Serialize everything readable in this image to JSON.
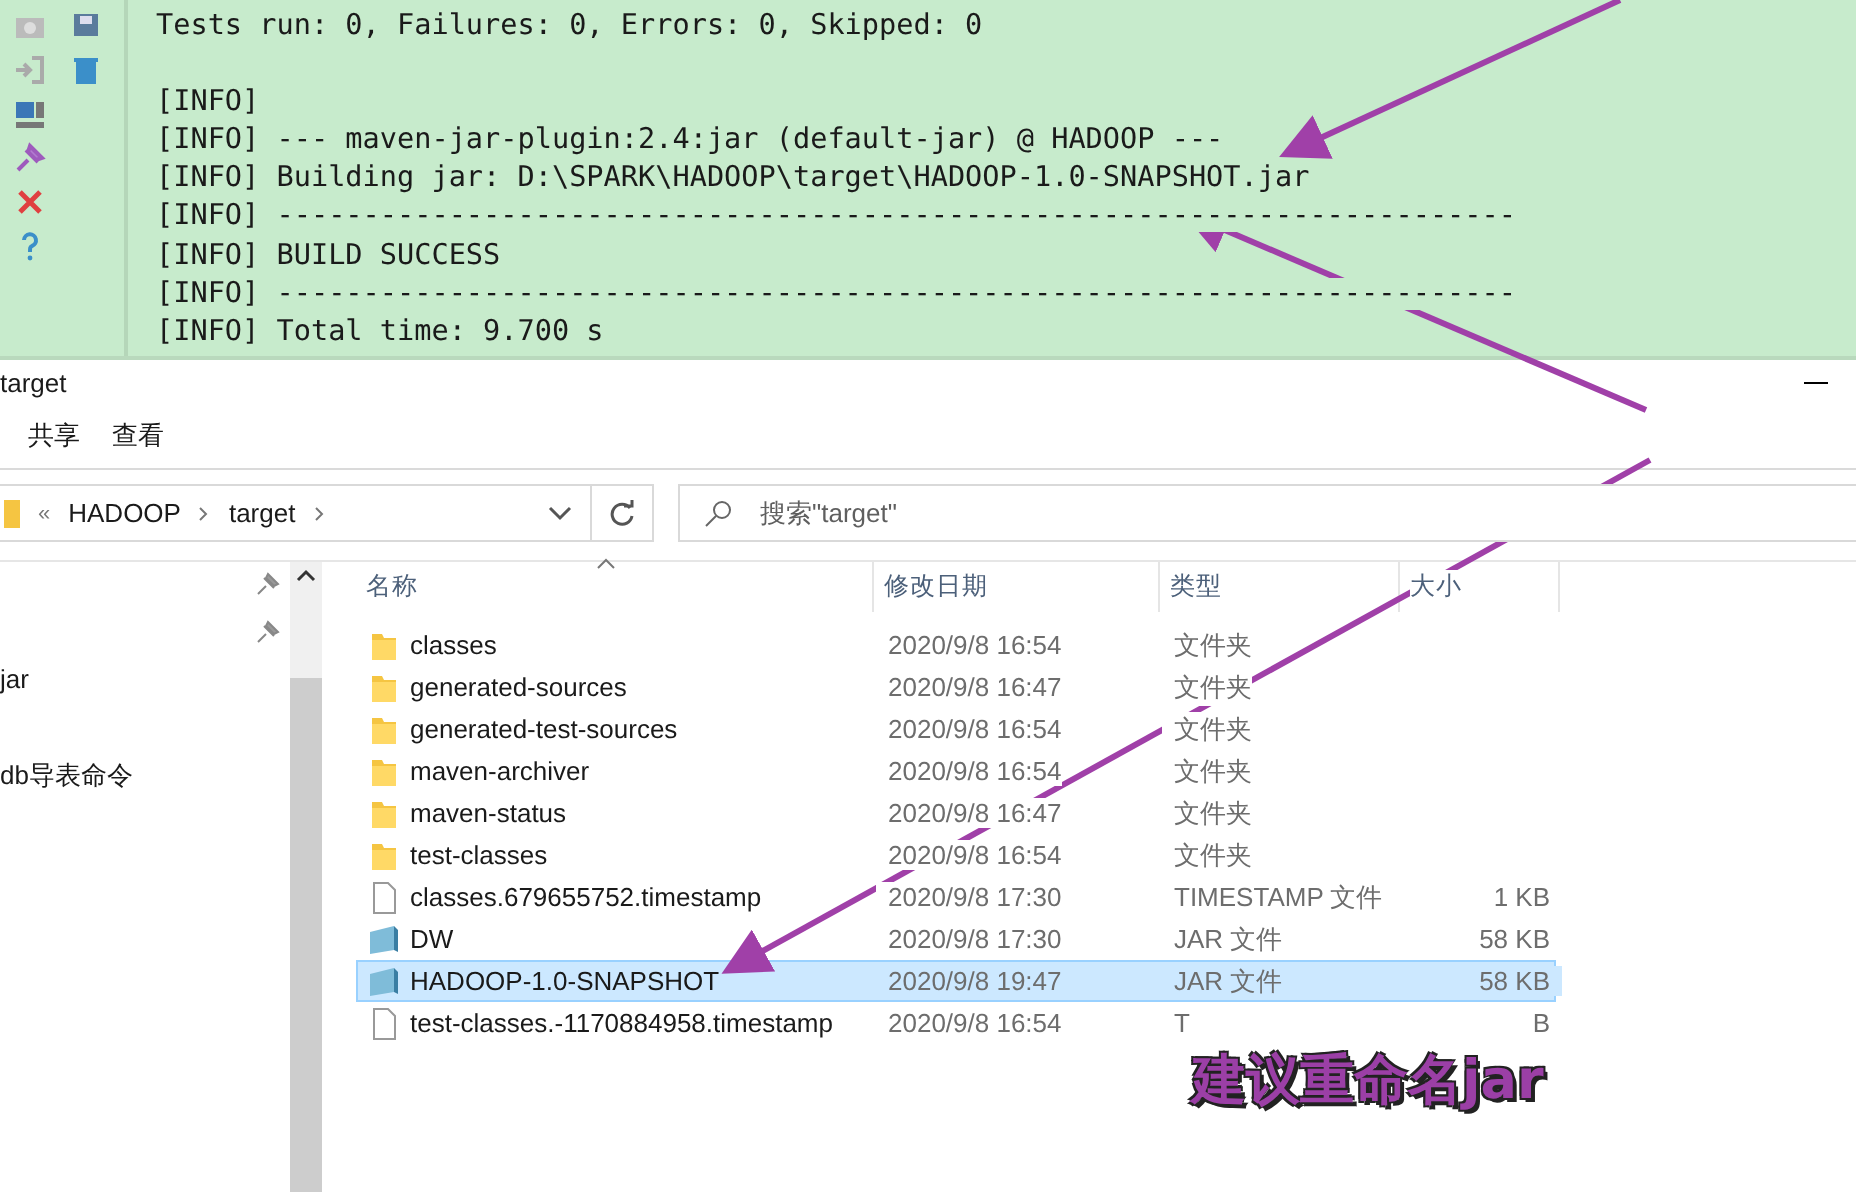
{
  "console": {
    "lines": [
      "Tests run: 0, Failures: 0, Errors: 0, Skipped: 0",
      "[INFO]",
      "[INFO] --- maven-jar-plugin:2.4:jar (default-jar) @ HADOOP ---",
      "[INFO] Building jar: D:\\SPARK\\HADOOP\\target\\HADOOP-1.0-SNAPSHOT.jar",
      "[INFO] ------------------------------------------------------------------------",
      "[INFO] BUILD SUCCESS",
      "[INFO] ------------------------------------------------------------------------",
      "[INFO] Total time: 9.700 s"
    ]
  },
  "window": {
    "title": "target"
  },
  "ribbon_tabs": [
    {
      "label": "共享",
      "selected": false
    },
    {
      "label": "查看",
      "selected": false
    }
  ],
  "address_bar": {
    "overflow": "«",
    "breadcrumbs": [
      "HADOOP",
      "target"
    ]
  },
  "search": {
    "placeholder": "搜索\"target\""
  },
  "navigation_pane": {
    "items": [
      "jar",
      "db导表命令"
    ]
  },
  "columns": [
    "名称",
    "修改日期",
    "类型",
    "大小"
  ],
  "files": [
    {
      "kind": "folder",
      "name": "classes",
      "date": "2020/9/8 16:54",
      "type": "文件夹",
      "selected": false
    },
    {
      "kind": "folder",
      "name": "generated-sources",
      "date": "2020/9/8 16:47",
      "type": "文件夹",
      "selected": false
    },
    {
      "kind": "folder",
      "name": "generated-test-sources",
      "date": "2020/9/8 16:54",
      "type": "文件夹",
      "selected": false
    },
    {
      "kind": "folder",
      "name": "maven-archiver",
      "date": "2020/9/8 16:54",
      "type": "文件夹",
      "selected": false
    },
    {
      "kind": "folder",
      "name": "maven-status",
      "date": "2020/9/8 16:47",
      "type": "文件夹",
      "selected": false
    },
    {
      "kind": "folder",
      "name": "test-classes",
      "date": "2020/9/8 16:54",
      "type": "文件夹",
      "selected": false
    },
    {
      "kind": "file",
      "name": "classes.679655752.timestamp",
      "date": "2020/9/8 17:30",
      "type": "TIMESTAMP 文件",
      "size": "1 KB",
      "selected": false
    },
    {
      "kind": "jar",
      "name": "DW",
      "date": "2020/9/8 17:30",
      "type": "JAR 文件",
      "size": "58 KB",
      "selected": false
    },
    {
      "kind": "jar",
      "name": "HADOOP-1.0-SNAPSHOT",
      "date": "2020/9/8 19:47",
      "type": "JAR 文件",
      "size": "58 KB",
      "selected": true
    },
    {
      "kind": "file",
      "name": "test-classes.-1170884958.timestamp",
      "date": "2020/9/8 16:54",
      "type": "T",
      "size": "B",
      "selected": false
    }
  ],
  "annotation": {
    "text": "建议重命名jar"
  }
}
